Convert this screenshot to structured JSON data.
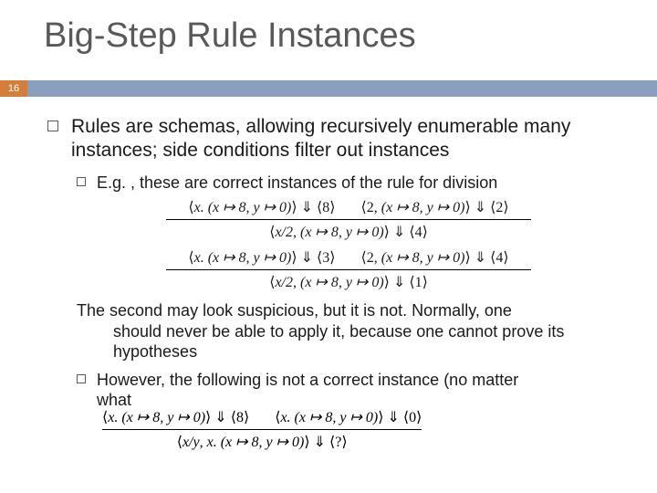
{
  "title": "Big-Step Rule Instances",
  "page": "16",
  "bullets": {
    "main": "Rules are schemas, allowing recursively enumerable many instances; side conditions filter out instances",
    "sub1": "E.g. , these are correct instances of the rule for division",
    "note_line1": "The second may look suspicious, but it is not.  Normally, one",
    "note_line2": "should never be able to apply it, because one cannot prove its",
    "note_line3": "hypotheses",
    "sub2a": "However, the following is not a correct instance (no matter",
    "sub2b": "what"
  },
  "rules": [
    {
      "state": "x. (x ↦ 8, y ↦ 0)",
      "state2": "(x ↦ 8, y ↦ 0)",
      "p1v": "8",
      "p2e": "2",
      "p2v": "2",
      "ce": "x/2",
      "cv": "4"
    },
    {
      "state": "x. (x ↦ 8, y ↦ 0)",
      "state2": "(x ↦ 8, y ↦ 0)",
      "p1v": "3",
      "p2e": "2",
      "p2v": "4",
      "ce": "x/2",
      "cv": "1"
    },
    {
      "state": "x. (x ↦ 8, y ↦ 0)",
      "p1v": "8",
      "p2v": "0",
      "ce": "x/y",
      "cv": "?"
    }
  ]
}
